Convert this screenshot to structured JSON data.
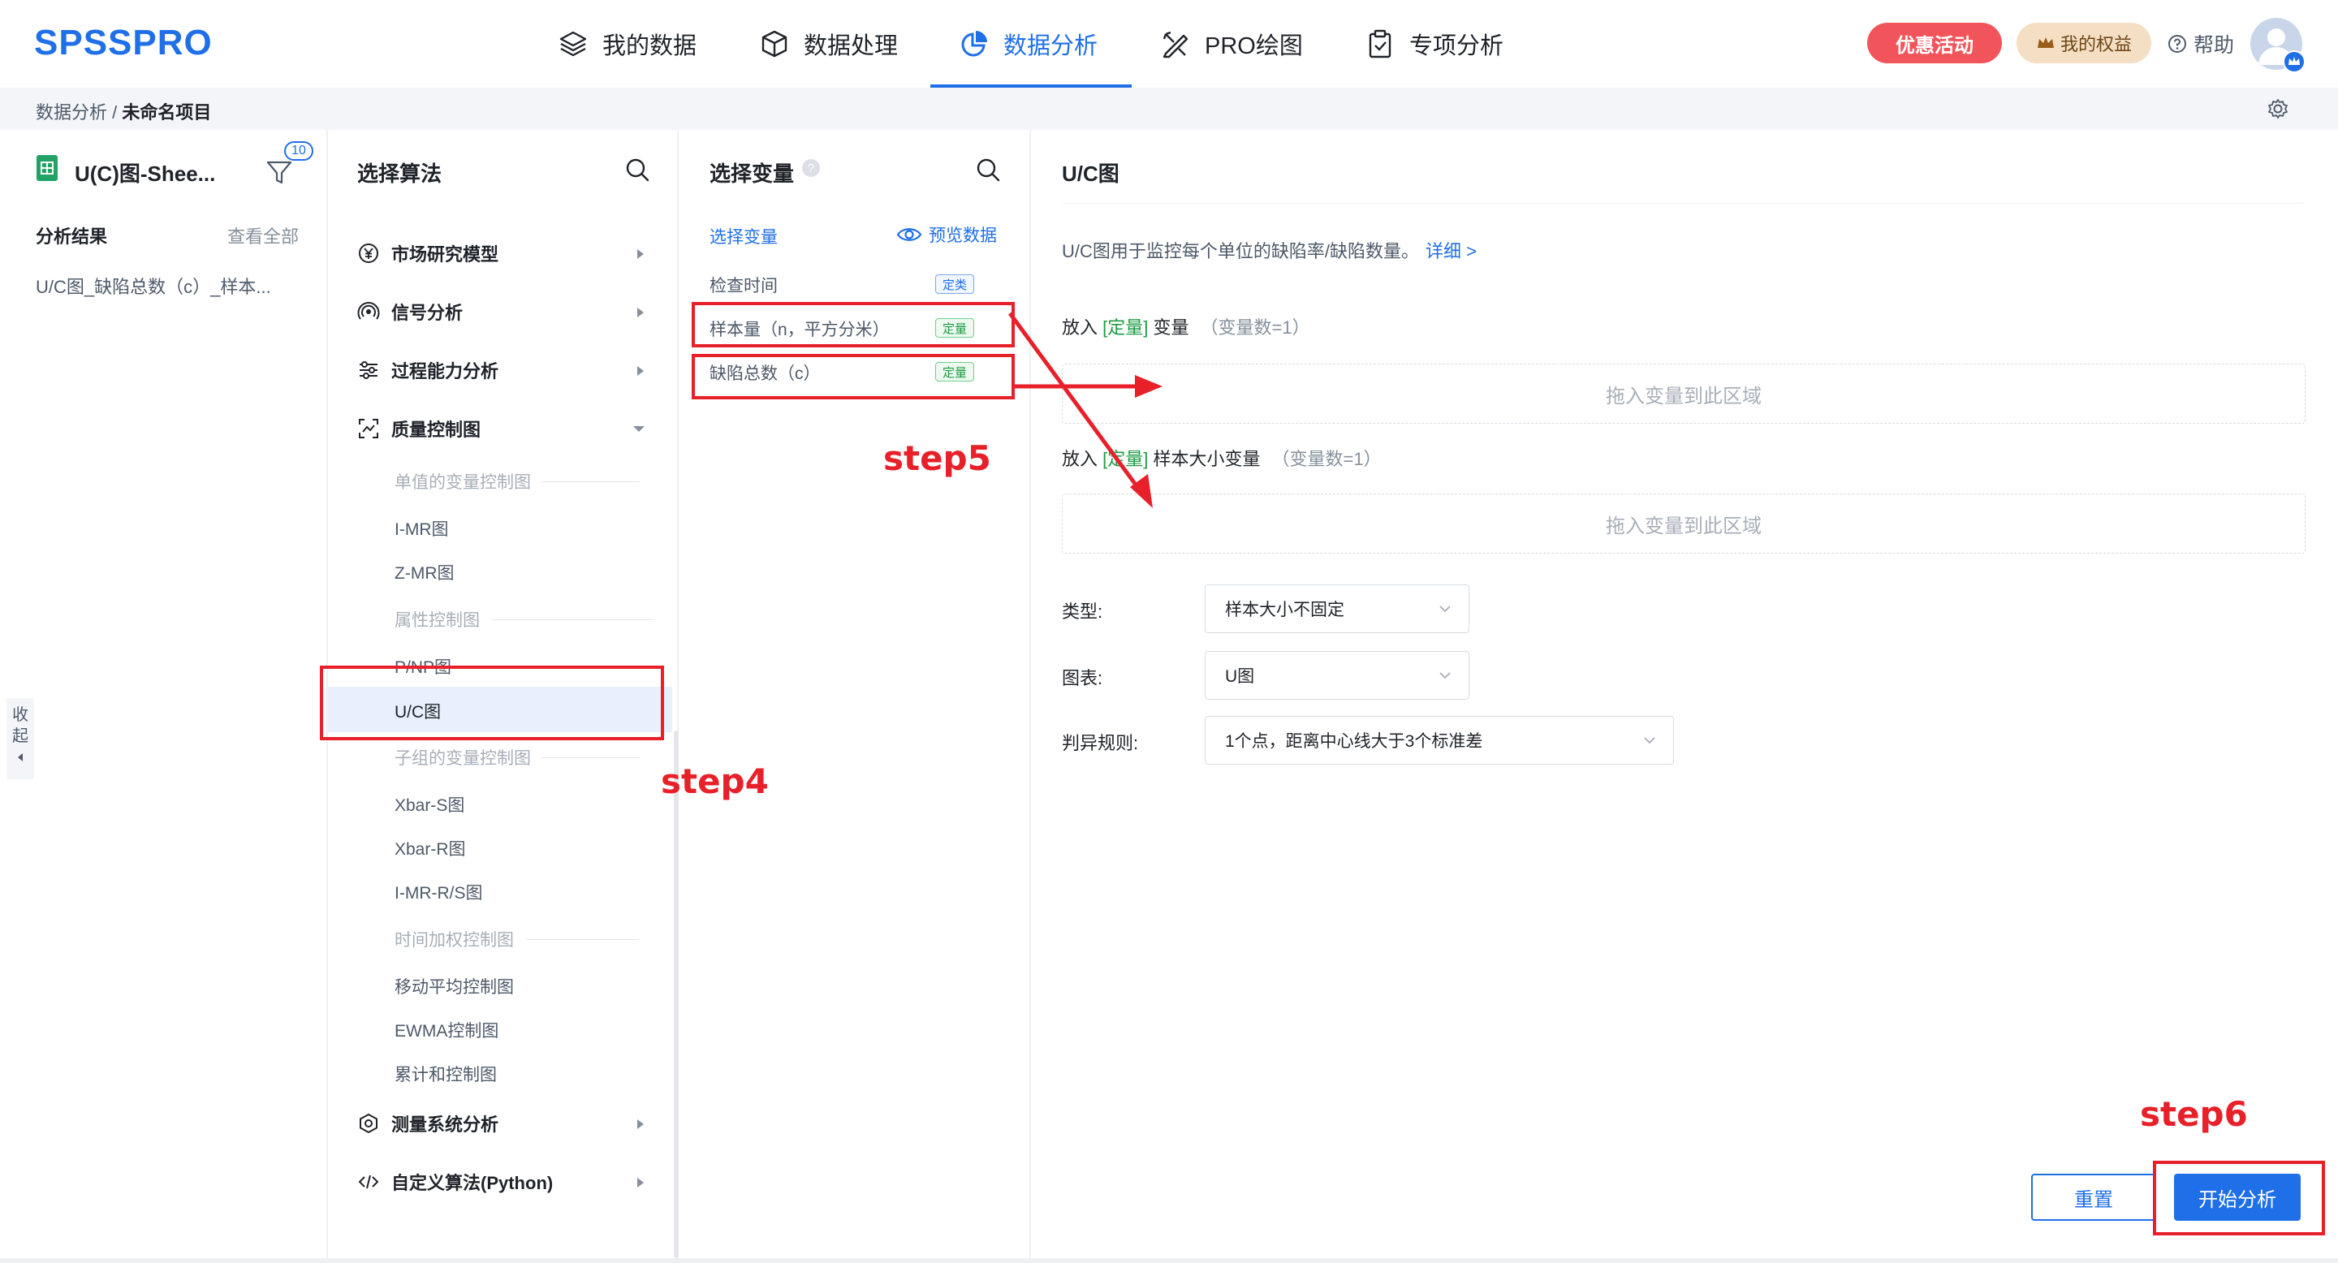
{
  "app": {
    "logo": "SPSSPRO"
  },
  "nav": {
    "items": [
      {
        "label": "我的数据",
        "icon": "layers-icon"
      },
      {
        "label": "数据处理",
        "icon": "cube-icon"
      },
      {
        "label": "数据分析",
        "icon": "pie-chart-icon",
        "active": true
      },
      {
        "label": "PRO绘图",
        "icon": "drawing-tools-icon"
      },
      {
        "label": "专项分析",
        "icon": "clipboard-icon"
      }
    ],
    "promo": "优惠活动",
    "rights": "我的权益",
    "help": "帮助"
  },
  "breadcrumb": {
    "parent": "数据分析",
    "sep": " / ",
    "current": "未命名项目"
  },
  "sheet": {
    "name": "U(C)图-Shee...",
    "filter_count": "10",
    "results_label": "分析结果",
    "view_all": "查看全部",
    "result_item": "U/C图_缺陷总数（c）_样本...",
    "collapse_label": "收起"
  },
  "algorithms": {
    "title": "选择算法",
    "categories": [
      {
        "label": "市场研究模型",
        "icon": "yen-circle-icon"
      },
      {
        "label": "信号分析",
        "icon": "signal-icon"
      },
      {
        "label": "过程能力分析",
        "icon": "sliders-icon"
      },
      {
        "label": "质量控制图",
        "icon": "scan-icon"
      },
      {
        "label": "测量系统分析",
        "icon": "gauge-icon"
      },
      {
        "label": "自定义算法(Python)",
        "icon": "code-icon"
      }
    ],
    "groups": [
      "单值的变量控制图",
      "属性控制图",
      "子组的变量控制图",
      "时间加权控制图"
    ],
    "items": {
      "imr": "I-MR图",
      "zmr": "Z-MR图",
      "pnp": "P/NP图",
      "uc": "U/C图",
      "xbars": "Xbar-S图",
      "xbarr": "Xbar-R图",
      "imrrs": "I-MR-R/S图",
      "ma": "移动平均控制图",
      "ewma": "EWMA控制图",
      "cusum": "累计和控制图"
    }
  },
  "variables": {
    "title": "选择变量",
    "select_link": "选择变量",
    "preview_link": "预览数据",
    "rows": [
      {
        "name": "检查时间",
        "tag": "定类",
        "tag_color": "#1f6fe8"
      },
      {
        "name": "样本量（n，平方分米）",
        "tag": "定量",
        "tag_color": "#1e9b43"
      },
      {
        "name": "缺陷总数（c）",
        "tag": "定量",
        "tag_color": "#1e9b43"
      }
    ]
  },
  "config": {
    "title": "U/C图",
    "description": "U/C图用于监控每个单位的缺陷率/缺陷数量。",
    "detail_link": "详细 >",
    "slot1": {
      "prefix": "放入 ",
      "type": "[定量]",
      "suffix": " 变量",
      "count": "（变量数=1）",
      "placeholder": "拖入变量到此区域"
    },
    "slot2": {
      "prefix": "放入 ",
      "type": "[定量]",
      "suffix": " 样本大小变量",
      "count": "（变量数=1）",
      "placeholder": "拖入变量到此区域"
    },
    "type_label": "类型:",
    "type_value": "样本大小不固定",
    "chart_label": "图表:",
    "chart_value": "U图",
    "rule_label": "判异规则:",
    "rule_value": "1个点，距离中心线大于3个标准差",
    "reset": "重置",
    "start": "开始分析"
  },
  "annotations": {
    "step4": "step4",
    "step5": "step5",
    "step6": "step6",
    "color": "#e8202a"
  }
}
